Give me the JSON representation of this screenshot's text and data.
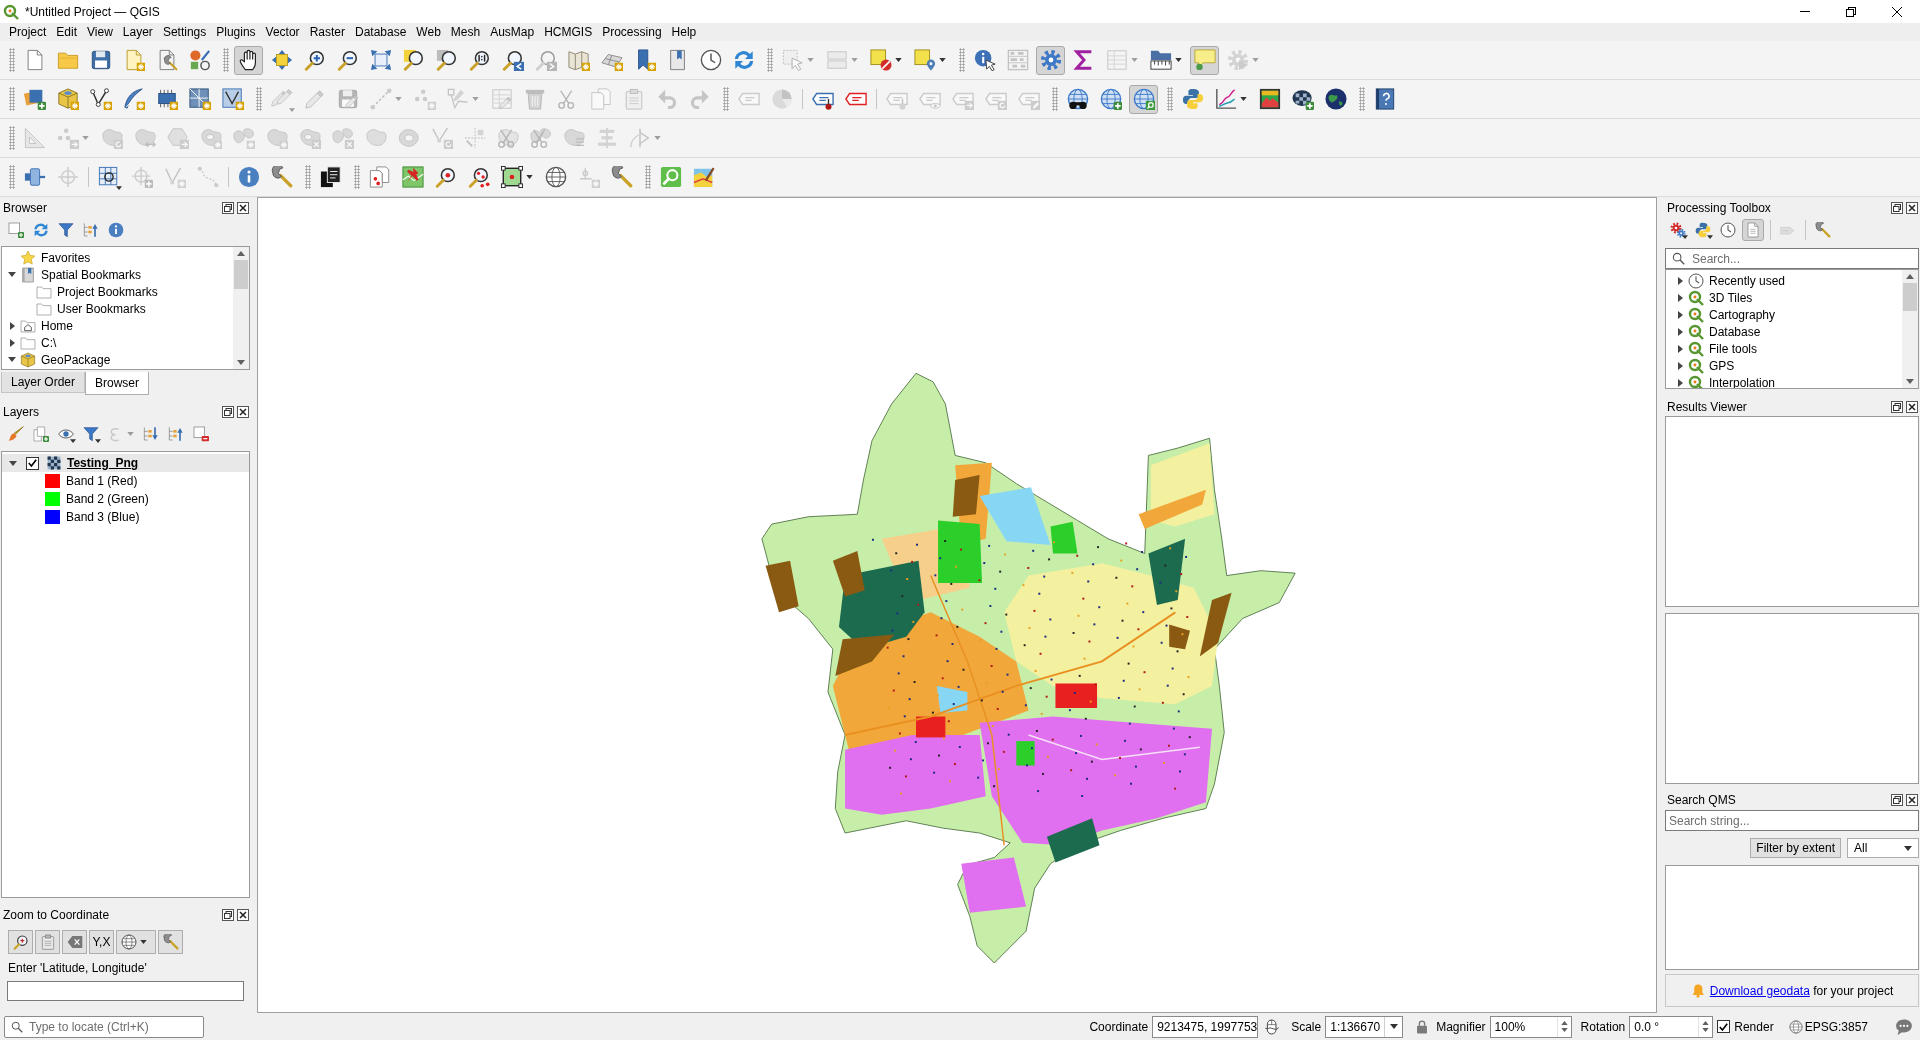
{
  "window": {
    "title": "*Untitled Project — QGIS"
  },
  "menu_bar": [
    "Project",
    "Edit",
    "View",
    "Layer",
    "Settings",
    "Plugins",
    "Vector",
    "Raster",
    "Database",
    "Web",
    "Mesh",
    "AusMap",
    "HCMGIS",
    "Processing",
    "Help"
  ],
  "toolbars": [
    {
      "sections": [
        {
          "items": [
            {
              "kind": "button",
              "disabled": false,
              "pressed": false
            },
            {
              "kind": "button",
              "disabled": false,
              "pressed": false
            },
            {
              "kind": "button",
              "disabled": false,
              "pressed": false
            },
            {
              "kind": "button",
              "disabled": false,
              "pressed": false
            },
            {
              "kind": "button",
              "disabled": false,
              "pressed": false
            },
            {
              "kind": "button",
              "disabled": false,
              "pressed": false
            }
          ]
        },
        {
          "items": [
            {
              "kind": "button",
              "disabled": false,
              "pressed": true
            },
            {
              "kind": "button",
              "disabled": false,
              "pressed": false
            },
            {
              "kind": "button",
              "disabled": false,
              "pressed": false
            },
            {
              "kind": "button",
              "disabled": false,
              "pressed": false
            },
            {
              "kind": "button",
              "disabled": false,
              "pressed": false
            },
            {
              "kind": "button",
              "disabled": false,
              "pressed": false
            },
            {
              "kind": "button",
              "disabled": false,
              "pressed": false
            },
            {
              "kind": "button",
              "disabled": false,
              "pressed": false
            },
            {
              "kind": "button",
              "disabled": false,
              "pressed": false
            },
            {
              "kind": "button",
              "disabled": true,
              "pressed": false
            },
            {
              "kind": "button",
              "disabled": false,
              "pressed": false
            },
            {
              "kind": "button",
              "disabled": false,
              "pressed": false
            },
            {
              "kind": "button",
              "disabled": false,
              "pressed": false
            },
            {
              "kind": "button",
              "disabled": false,
              "pressed": false
            },
            {
              "kind": "button",
              "disabled": false,
              "pressed": false
            },
            {
              "kind": "button",
              "disabled": false,
              "pressed": false
            }
          ]
        },
        {
          "items": [
            {
              "kind": "split",
              "disabled": true,
              "pressed": false
            },
            {
              "kind": "split",
              "disabled": true,
              "pressed": false
            },
            {
              "kind": "split",
              "disabled": false,
              "pressed": false
            },
            {
              "kind": "split",
              "disabled": false,
              "pressed": false
            }
          ]
        },
        {
          "items": [
            {
              "kind": "button",
              "disabled": false,
              "pressed": false
            },
            {
              "kind": "button",
              "disabled": true,
              "pressed": false
            },
            {
              "kind": "button",
              "disabled": false,
              "pressed": true
            },
            {
              "kind": "button",
              "disabled": false,
              "pressed": false
            },
            {
              "kind": "split",
              "disabled": true,
              "pressed": false
            },
            {
              "kind": "split",
              "disabled": false,
              "pressed": false
            },
            {
              "kind": "button",
              "disabled": false,
              "pressed": true
            },
            {
              "kind": "split",
              "disabled": true,
              "pressed": false
            }
          ]
        }
      ]
    },
    {
      "sections": [
        {
          "items": [
            {
              "kind": "button",
              "disabled": false,
              "pressed": false
            },
            {
              "kind": "button",
              "disabled": false,
              "pressed": false
            },
            {
              "kind": "button",
              "disabled": false,
              "pressed": false
            },
            {
              "kind": "button",
              "disabled": false,
              "pressed": false
            },
            {
              "kind": "button",
              "disabled": false,
              "pressed": false
            },
            {
              "kind": "button",
              "disabled": false,
              "pressed": false
            },
            {
              "kind": "button",
              "disabled": false,
              "pressed": false
            }
          ]
        },
        {
          "items": [
            {
              "kind": "menu",
              "disabled": true,
              "pressed": false
            },
            {
              "kind": "button",
              "disabled": true,
              "pressed": false
            },
            {
              "kind": "button",
              "disabled": true,
              "pressed": false
            },
            {
              "kind": "split",
              "disabled": true,
              "pressed": false
            },
            {
              "kind": "button",
              "disabled": true,
              "pressed": false
            },
            {
              "kind": "split",
              "disabled": true,
              "pressed": false
            },
            {
              "kind": "button",
              "disabled": true,
              "pressed": false
            },
            {
              "kind": "button",
              "disabled": true,
              "pressed": false
            },
            {
              "kind": "button",
              "disabled": true,
              "pressed": false
            },
            {
              "kind": "button",
              "disabled": true,
              "pressed": false
            },
            {
              "kind": "button",
              "disabled": true,
              "pressed": false
            },
            {
              "kind": "button",
              "disabled": true,
              "pressed": false
            },
            {
              "kind": "button",
              "disabled": true,
              "pressed": false
            }
          ]
        },
        {
          "items": [
            {
              "kind": "button",
              "disabled": true,
              "pressed": false
            },
            {
              "kind": "button",
              "disabled": true,
              "pressed": false
            },
            {
              "kind": "separator"
            },
            {
              "kind": "button",
              "disabled": false,
              "pressed": false
            },
            {
              "kind": "button",
              "disabled": false,
              "pressed": false
            },
            {
              "kind": "separator"
            },
            {
              "kind": "button",
              "disabled": true,
              "pressed": false
            },
            {
              "kind": "button",
              "disabled": true,
              "pressed": false
            },
            {
              "kind": "button",
              "disabled": true,
              "pressed": false
            },
            {
              "kind": "button",
              "disabled": true,
              "pressed": false
            },
            {
              "kind": "button",
              "disabled": true,
              "pressed": false
            }
          ]
        },
        {
          "items": [
            {
              "kind": "button",
              "disabled": false,
              "pressed": false
            },
            {
              "kind": "button",
              "disabled": false,
              "pressed": false
            },
            {
              "kind": "button",
              "disabled": false,
              "pressed": true
            }
          ]
        },
        {
          "items": [
            {
              "kind": "button",
              "disabled": false,
              "pressed": false
            },
            {
              "kind": "split",
              "disabled": false,
              "pressed": false
            },
            {
              "kind": "button",
              "disabled": false,
              "pressed": false
            },
            {
              "kind": "button",
              "disabled": false,
              "pressed": false
            },
            {
              "kind": "button",
              "disabled": false,
              "pressed": false
            }
          ]
        },
        {
          "items": [
            {
              "kind": "button",
              "disabled": false,
              "pressed": false
            }
          ]
        }
      ]
    },
    {
      "sections": [
        {
          "items": [
            {
              "kind": "button",
              "disabled": true,
              "pressed": false
            },
            {
              "kind": "split",
              "disabled": true,
              "pressed": false
            },
            {
              "kind": "button",
              "disabled": true,
              "pressed": false
            },
            {
              "kind": "button",
              "disabled": true,
              "pressed": false
            },
            {
              "kind": "button",
              "disabled": true,
              "pressed": false
            },
            {
              "kind": "button",
              "disabled": true,
              "pressed": false
            },
            {
              "kind": "button",
              "disabled": true,
              "pressed": false
            },
            {
              "kind": "button",
              "disabled": true,
              "pressed": false
            },
            {
              "kind": "button",
              "disabled": true,
              "pressed": false
            },
            {
              "kind": "button",
              "disabled": true,
              "pressed": false
            },
            {
              "kind": "button",
              "disabled": true,
              "pressed": false
            },
            {
              "kind": "button",
              "disabled": true,
              "pressed": false
            },
            {
              "kind": "button",
              "disabled": true,
              "pressed": false
            },
            {
              "kind": "button",
              "disabled": true,
              "pressed": false
            },
            {
              "kind": "button",
              "disabled": true,
              "pressed": false
            },
            {
              "kind": "button",
              "disabled": true,
              "pressed": false
            },
            {
              "kind": "button",
              "disabled": true,
              "pressed": false
            },
            {
              "kind": "button",
              "disabled": true,
              "pressed": false
            },
            {
              "kind": "split",
              "disabled": true,
              "pressed": false
            }
          ]
        }
      ]
    },
    {
      "sections": [
        {
          "items": [
            {
              "kind": "button",
              "disabled": false,
              "pressed": false
            },
            {
              "kind": "button",
              "disabled": true,
              "pressed": false
            },
            {
              "kind": "separator"
            },
            {
              "kind": "menu",
              "disabled": false,
              "pressed": false
            },
            {
              "kind": "button",
              "disabled": true,
              "pressed": false
            },
            {
              "kind": "button",
              "disabled": true,
              "pressed": false
            },
            {
              "kind": "button",
              "disabled": true,
              "pressed": false
            },
            {
              "kind": "separator"
            },
            {
              "kind": "button",
              "disabled": false,
              "pressed": false
            },
            {
              "kind": "button",
              "disabled": false,
              "pressed": false
            }
          ]
        },
        {
          "items": [
            {
              "kind": "button",
              "disabled": false,
              "pressed": false
            }
          ]
        },
        {
          "items": [
            {
              "kind": "button",
              "disabled": false,
              "pressed": false
            },
            {
              "kind": "button",
              "disabled": false,
              "pressed": false
            },
            {
              "kind": "button",
              "disabled": false,
              "pressed": false
            },
            {
              "kind": "button",
              "disabled": false,
              "pressed": false
            },
            {
              "kind": "split",
              "disabled": false,
              "pressed": false
            },
            {
              "kind": "button",
              "disabled": false,
              "pressed": false
            },
            {
              "kind": "button",
              "disabled": true,
              "pressed": false
            },
            {
              "kind": "button",
              "disabled": false,
              "pressed": false
            }
          ]
        },
        {
          "items": [
            {
              "kind": "button",
              "disabled": false,
              "pressed": false
            },
            {
              "kind": "button",
              "disabled": false,
              "pressed": false
            }
          ]
        }
      ]
    }
  ],
  "browser_panel": {
    "title": "Browser",
    "toolbar": [
      {
        "kind": "button",
        "disabled": false,
        "pressed": false
      },
      {
        "kind": "button",
        "disabled": false,
        "pressed": false
      },
      {
        "kind": "button",
        "disabled": false,
        "pressed": false
      },
      {
        "kind": "button",
        "disabled": false,
        "pressed": false
      },
      {
        "kind": "button",
        "disabled": false,
        "pressed": false
      }
    ],
    "tree": [
      {
        "label": "Favorites"
      },
      {
        "label": "Spatial Bookmarks",
        "expanded": true,
        "children": [
          {
            "label": "Project Bookmarks"
          },
          {
            "label": "User Bookmarks"
          }
        ]
      },
      {
        "label": "Home",
        "expanded": false
      },
      {
        "label": "C:\\",
        "expanded": false
      },
      {
        "label": "GeoPackage",
        "expanded": true
      }
    ]
  },
  "dock_tabs": [
    {
      "label": "Layer Order",
      "selected": false
    },
    {
      "label": "Browser",
      "selected": true
    }
  ],
  "layers_panel": {
    "title": "Layers",
    "toolbar": [
      {
        "kind": "button",
        "disabled": false,
        "pressed": false
      },
      {
        "kind": "button",
        "disabled": false,
        "pressed": false
      },
      {
        "kind": "menu",
        "disabled": false,
        "pressed": false
      },
      {
        "kind": "menu",
        "disabled": false,
        "pressed": false
      },
      {
        "kind": "split",
        "disabled": true,
        "pressed": false
      },
      {
        "kind": "button",
        "disabled": false,
        "pressed": false
      },
      {
        "kind": "button",
        "disabled": false,
        "pressed": false
      },
      {
        "kind": "button",
        "disabled": false,
        "pressed": false
      }
    ],
    "layers": [
      {
        "name": "Testing_Png",
        "checked": true,
        "expanded": true,
        "selected": true,
        "bands": [
          {
            "label": "Band 1 (Red)",
            "color": "#ff0000"
          },
          {
            "label": "Band 2 (Green)",
            "color": "#00ff00"
          },
          {
            "label": "Band 3 (Blue)",
            "color": "#0000ff"
          }
        ]
      }
    ]
  },
  "zoom_to_coordinate": {
    "title": "Zoom to Coordinate",
    "toolbar": [
      {
        "kind": "button",
        "disabled": false,
        "pressed": false
      },
      {
        "kind": "button",
        "disabled": false,
        "pressed": false
      },
      {
        "kind": "button",
        "disabled": false,
        "pressed": false
      },
      {
        "kind": "button",
        "label": "Y,X",
        "disabled": false,
        "pressed": false
      },
      {
        "kind": "split",
        "disabled": false,
        "pressed": false
      },
      {
        "kind": "button",
        "disabled": false,
        "pressed": false
      }
    ],
    "label": "Enter 'Latitude, Longitude'"
  },
  "processing_toolbox": {
    "title": "Processing Toolbox",
    "toolbar": [
      {
        "kind": "menu",
        "disabled": false,
        "pressed": false
      },
      {
        "kind": "menu",
        "disabled": false,
        "pressed": false
      },
      {
        "kind": "button",
        "disabled": false,
        "pressed": false
      },
      {
        "kind": "button",
        "disabled": false,
        "pressed": true
      },
      {
        "kind": "separator"
      },
      {
        "kind": "button",
        "disabled": true,
        "pressed": false
      },
      {
        "kind": "separator"
      },
      {
        "kind": "button",
        "disabled": false,
        "pressed": false
      }
    ],
    "search": {
      "placeholder": "Search..."
    },
    "tree": [
      {
        "label": "Recently used",
        "expanded": false
      },
      {
        "label": "3D Tiles",
        "expanded": false
      },
      {
        "label": "Cartography",
        "expanded": false
      },
      {
        "label": "Database",
        "expanded": false
      },
      {
        "label": "File tools",
        "expanded": false
      },
      {
        "label": "GPS",
        "expanded": false
      },
      {
        "label": "Interpolation",
        "expanded": false
      }
    ]
  },
  "results_viewer": {
    "title": "Results Viewer"
  },
  "search_qms": {
    "title": "Search QMS",
    "search": {
      "placeholder": "Search string..."
    },
    "filter_button": "Filter by extent",
    "filter_select": "All",
    "banner": {
      "link": "Download geodata",
      "text": "for your project"
    }
  },
  "status_bar": {
    "locator": {
      "placeholder": "Type to locate (Ctrl+K)"
    },
    "coordinate": {
      "label": "Coordinate",
      "value": "9213475, 1997753"
    },
    "scale": {
      "label": "Scale",
      "value": "1:136670"
    },
    "magnifier": {
      "label": "Magnifier",
      "value": "100%"
    },
    "rotation": {
      "label": "Rotation",
      "value": "0.0 °"
    },
    "render": {
      "label": "Render",
      "checked": true
    },
    "crs": "EPSG:3857"
  }
}
